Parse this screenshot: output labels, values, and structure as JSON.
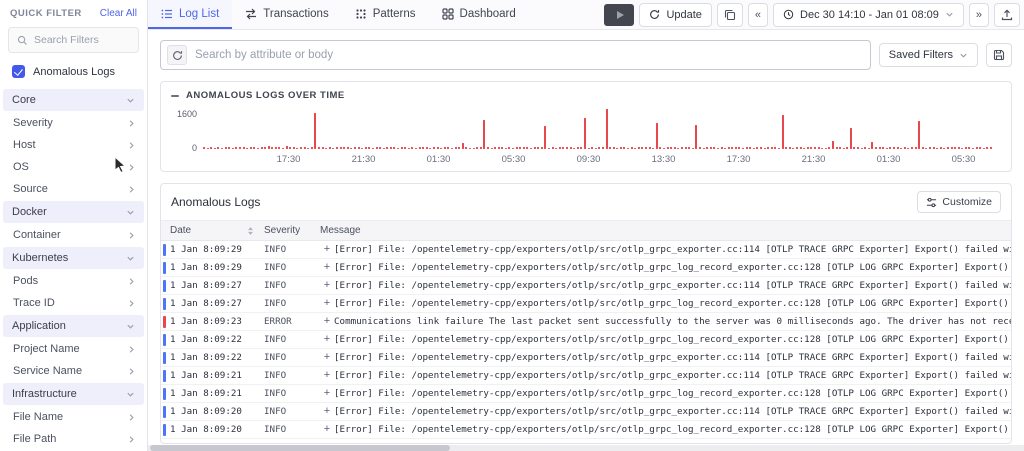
{
  "colors": {
    "accent_blue": "#4e66e8",
    "bar_red": "#e5484d",
    "info_indicator": "#4e74f8",
    "error_indicator": "#e5484d"
  },
  "sidebar": {
    "title": "QUICK FILTER",
    "clear_all_label": "Clear All",
    "search_placeholder": "Search Filters",
    "anomalous_checkbox_label": "Anomalous Logs",
    "sections": [
      {
        "label": "Core",
        "items": [
          "Severity",
          "Host",
          "OS",
          "Source"
        ]
      },
      {
        "label": "Docker",
        "items": [
          "Container"
        ]
      },
      {
        "label": "Kubernetes",
        "items": [
          "Pods",
          "Trace ID"
        ]
      },
      {
        "label": "Application",
        "items": [
          "Project Name",
          "Service Name"
        ]
      },
      {
        "label": "Infrastructure",
        "items": [
          "File Name",
          "File Path"
        ]
      }
    ]
  },
  "topbar": {
    "tabs": [
      {
        "label": "Log List",
        "icon": "list-icon",
        "active": true
      },
      {
        "label": "Transactions",
        "icon": "transactions-icon",
        "active": false
      },
      {
        "label": "Patterns",
        "icon": "patterns-icon",
        "active": false
      },
      {
        "label": "Dashboard",
        "icon": "dashboard-icon",
        "active": false
      }
    ],
    "update_label": "Update",
    "date_range": "Dec 30 14:10 - Jan 01 08:09",
    "prev_label": "«",
    "next_label": "»"
  },
  "search": {
    "placeholder": "Search by attribute or body",
    "saved_filters_label": "Saved Filters"
  },
  "chart_data": {
    "type": "bar",
    "title": "ANOMALOUS LOGS OVER TIME",
    "ylim": [
      0,
      1600
    ],
    "y_ticks": [
      "1600",
      "0"
    ],
    "x_ticks": [
      "17:30",
      "21:30",
      "01:30",
      "05:30",
      "09:30",
      "13:30",
      "17:30",
      "21:30",
      "01:30",
      "05:30"
    ],
    "bar_color": "#e5484d",
    "grid": false,
    "values": [
      60,
      45,
      80,
      55,
      70,
      40,
      90,
      65,
      50,
      75,
      85,
      60,
      45,
      95,
      70,
      55,
      80,
      65,
      120,
      75,
      90,
      60,
      45,
      110,
      70,
      85,
      55,
      65,
      75,
      50,
      95,
      1450,
      80,
      60,
      45,
      70,
      55,
      85,
      65,
      90,
      75,
      50,
      60,
      85,
      45,
      70,
      95,
      55,
      80,
      65,
      40,
      75,
      90,
      60,
      50,
      85,
      70,
      45,
      65,
      55,
      80,
      95,
      60,
      45,
      70,
      85,
      55,
      75,
      65,
      50,
      90,
      60,
      240,
      80,
      55,
      45,
      70,
      95,
      1150,
      65,
      50,
      85,
      60,
      75,
      45,
      90,
      55,
      70,
      80,
      65,
      95,
      50,
      60,
      75,
      85,
      900,
      45,
      70,
      55,
      65,
      80,
      60,
      90,
      50,
      75,
      65,
      1250,
      45,
      85,
      55,
      70,
      95,
      1600,
      60,
      80,
      45,
      65,
      75,
      55,
      90,
      50,
      70,
      85,
      60,
      95,
      45,
      1050,
      75,
      55,
      80,
      65,
      90,
      50,
      60,
      85,
      70,
      45,
      950,
      65,
      55,
      75,
      90,
      60,
      45,
      80,
      55,
      70,
      95,
      65,
      85,
      50,
      60,
      75,
      45,
      90,
      80,
      55,
      65,
      70,
      85,
      45,
      1350,
      60,
      95,
      55,
      75,
      80,
      50,
      65,
      90,
      70,
      85,
      45,
      55,
      60,
      320,
      75,
      95,
      50,
      80,
      850,
      65,
      70,
      55,
      90,
      45,
      280,
      85,
      60,
      75,
      50,
      95,
      65,
      80,
      45,
      70,
      55,
      85,
      60,
      1100,
      75,
      50,
      90,
      65,
      45,
      80,
      55,
      70,
      95,
      60,
      85,
      50,
      75,
      65,
      45,
      90,
      60,
      55,
      80,
      70
    ]
  },
  "logs_panel": {
    "title": "Anomalous Logs",
    "customize_label": "Customize",
    "expand_glyph": "+",
    "columns": [
      "Date",
      "Severity",
      "Message"
    ],
    "rows": [
      {
        "date": "1 Jan 8:09:29",
        "severity": "INFO",
        "message": "[Error] File: /opentelemetry-cpp/exporters/otlp/src/otlp_grpc_exporter.cc:114 [OTLP TRACE GRPC Exporter] Export() failed with status_"
      },
      {
        "date": "1 Jan 8:09:29",
        "severity": "INFO",
        "message": "[Error] File: /opentelemetry-cpp/exporters/otlp/src/otlp_grpc_log_record_exporter.cc:128 [OTLP LOG GRPC Exporter] Export() failed: fa"
      },
      {
        "date": "1 Jan 8:09:27",
        "severity": "INFO",
        "message": "[Error] File: /opentelemetry-cpp/exporters/otlp/src/otlp_grpc_exporter.cc:114 [OTLP TRACE GRPC Exporter] Export() failed with status_"
      },
      {
        "date": "1 Jan 8:09:27",
        "severity": "INFO",
        "message": "[Error] File: /opentelemetry-cpp/exporters/otlp/src/otlp_grpc_log_record_exporter.cc:128 [OTLP LOG GRPC Exporter] Export() failed: fa"
      },
      {
        "date": "1 Jan 8:09:23",
        "severity": "ERROR",
        "message": "Communications link failure The last packet sent successfully to the server was 0 milliseconds ago. The driver has not received any p"
      },
      {
        "date": "1 Jan 8:09:22",
        "severity": "INFO",
        "message": "[Error] File: /opentelemetry-cpp/exporters/otlp/src/otlp_grpc_log_record_exporter.cc:128 [OTLP LOG GRPC Exporter] Export() failed: f"
      },
      {
        "date": "1 Jan 8:09:22",
        "severity": "INFO",
        "message": "[Error] File: /opentelemetry-cpp/exporters/otlp/src/otlp_grpc_exporter.cc:114 [OTLP TRACE GRPC Exporter] Export() failed with status_"
      },
      {
        "date": "1 Jan 8:09:21",
        "severity": "INFO",
        "message": "[Error] File: /opentelemetry-cpp/exporters/otlp/src/otlp_grpc_exporter.cc:114 [OTLP TRACE GRPC Exporter] Export() failed with status_"
      },
      {
        "date": "1 Jan 8:09:21",
        "severity": "INFO",
        "message": "[Error] File: /opentelemetry-cpp/exporters/otlp/src/otlp_grpc_log_record_exporter.cc:128 [OTLP LOG GRPC Exporter] Export() failed: f"
      },
      {
        "date": "1 Jan 8:09:20",
        "severity": "INFO",
        "message": "[Error] File: /opentelemetry-cpp/exporters/otlp/src/otlp_grpc_exporter.cc:114 [OTLP TRACE GRPC Exporter] Export() failed with status_"
      },
      {
        "date": "1 Jan 8:09:20",
        "severity": "INFO",
        "message": "[Error] File: /opentelemetry-cpp/exporters/otlp/src/otlp_grpc_log_record_exporter.cc:128 [OTLP LOG GRPC Exporter] Export() failed: fa"
      }
    ]
  }
}
